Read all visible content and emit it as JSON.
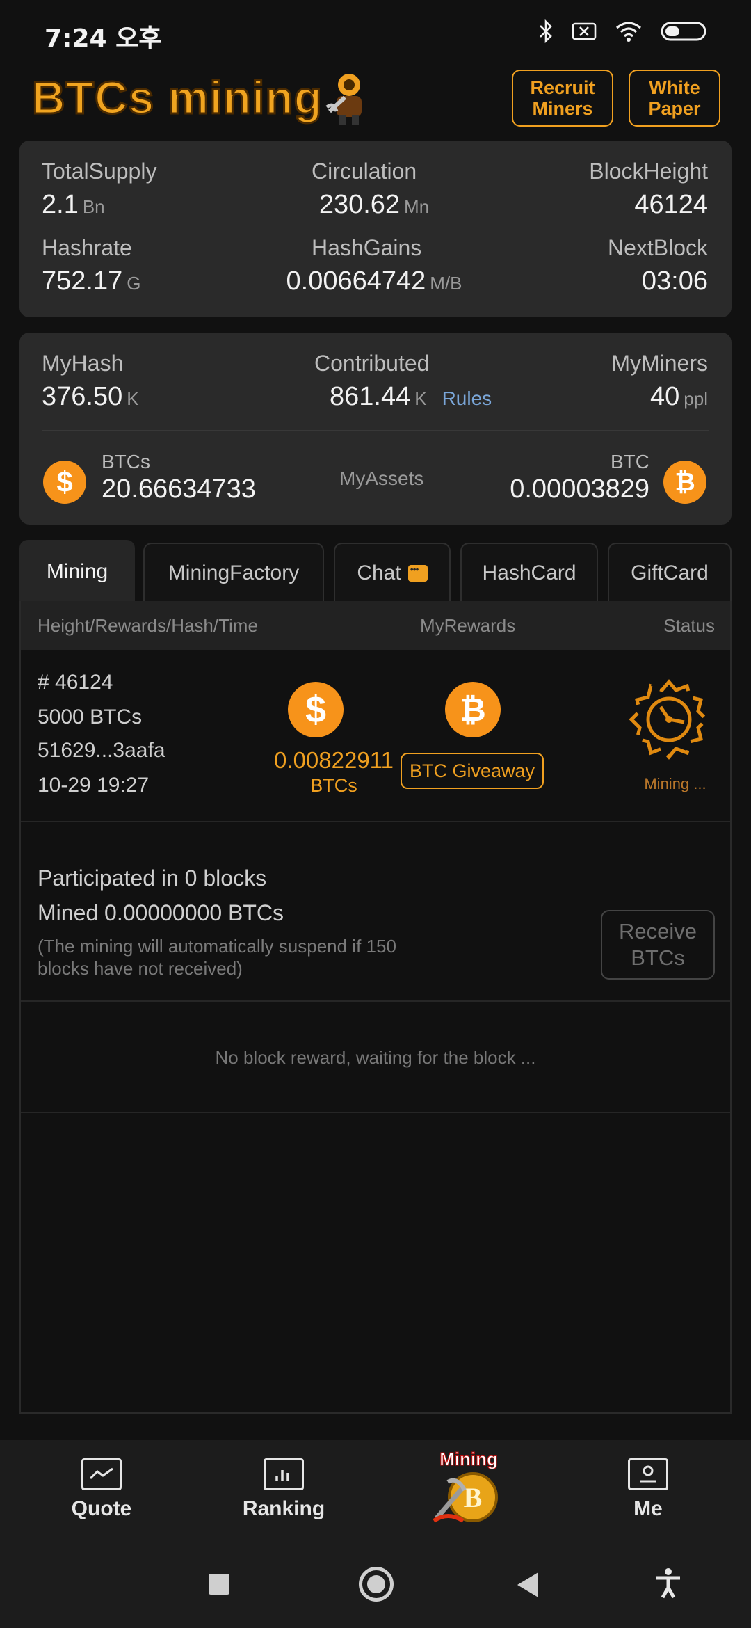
{
  "status_bar": {
    "time": "7:24 오후"
  },
  "header": {
    "logo_text": "BTCs mining",
    "recruit_label_1": "Recruit",
    "recruit_label_2": "Miners",
    "paper_label_1": "White",
    "paper_label_2": "Paper"
  },
  "network": {
    "total_supply_label": "TotalSupply",
    "total_supply": "2.1",
    "total_supply_unit": "Bn",
    "circulation_label": "Circulation",
    "circulation": "230.62",
    "circulation_unit": "Mn",
    "block_height_label": "BlockHeight",
    "block_height": "46124",
    "hashrate_label": "Hashrate",
    "hashrate": "752.17",
    "hashrate_unit": "G",
    "hash_gains_label": "HashGains",
    "hash_gains": "0.00664742",
    "hash_gains_unit": "M/B",
    "next_block_label": "NextBlock",
    "next_block": "03:06"
  },
  "mine": {
    "myhash_label": "MyHash",
    "myhash": "376.50",
    "myhash_unit": "K",
    "contributed_label": "Contributed",
    "contributed": "861.44",
    "contributed_unit": "K",
    "rules_label": "Rules",
    "myminers_label": "MyMiners",
    "myminers": "40",
    "myminers_unit": "ppl",
    "btcs_label": "BTCs",
    "btcs_value": "20.66634733",
    "myassets_label": "MyAssets",
    "btc_label": "BTC",
    "btc_value": "0.00003829"
  },
  "tabs": [
    "Mining",
    "MiningFactory",
    "Chat",
    "HashCard",
    "GiftCard"
  ],
  "table": {
    "col_info": "Height/Rewards/Hash/Time",
    "col_rewards": "MyRewards",
    "col_status": "Status",
    "row": {
      "height": "# 46124",
      "rewards": "5000 BTCs",
      "hash": "51629...3aafa",
      "time": "10-29 19:27",
      "btcs_amount": "0.00822911",
      "btcs_unit": "BTCs",
      "giveaway_label": "BTC Giveaway",
      "status": "Mining ..."
    }
  },
  "participation": {
    "blocks": "Participated in 0 blocks",
    "mined": "Mined 0.00000000 BTCs",
    "note": "(The mining will automatically suspend if 150 blocks have not received)",
    "receive_label_1": "Receive",
    "receive_label_2": "BTCs"
  },
  "empty_message": "No block reward, waiting for the block ...",
  "bottom_nav": {
    "quote": "Quote",
    "ranking": "Ranking",
    "mining": "Mining",
    "me": "Me"
  },
  "colors": {
    "accent": "#f0a020",
    "background": "#111111",
    "card": "#2a2a2a",
    "coin": "#f7931a"
  }
}
